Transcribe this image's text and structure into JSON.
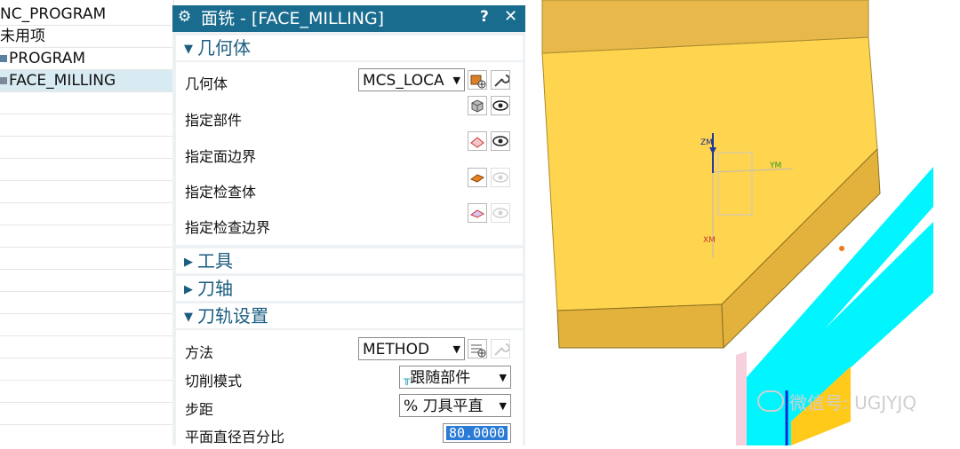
{
  "navigator": {
    "rows": [
      "NC_PROGRAM",
      "未用项",
      "PROGRAM",
      "FACE_MILLING"
    ]
  },
  "dialog": {
    "title": "面铣 - [FACE_MILLING]",
    "help": "?",
    "close": "✕",
    "geometry": {
      "header": "几何体",
      "geom_label": "几何体",
      "geom_value": "MCS_LOCA",
      "part_label": "指定部件",
      "face_boundary_label": "指定面边界",
      "check_body_label": "指定检查体",
      "check_boundary_label": "指定检查边界"
    },
    "tool": {
      "header": "工具"
    },
    "axis": {
      "header": "刀轴"
    },
    "path_settings": {
      "header": "刀轨设置",
      "method_label": "方法",
      "method_value": "METHOD",
      "cut_pattern_label": "切削模式",
      "cut_pattern_value": "跟随部件",
      "stepover_label": "步距",
      "stepover_value": "% 刀具平直",
      "percent_label": "平面直径百分比",
      "percent_value": "80.0000"
    }
  },
  "viewport": {
    "axis_z": "ZM",
    "axis_y": "YM",
    "axis_x": "XM",
    "watermark": "微信号: UGJYJQ"
  },
  "colors": {
    "title_bar": "#1a6c8f",
    "part_top": "#ffd44f",
    "part_side": "#e3b23c",
    "cyan": "#00f5ff"
  }
}
